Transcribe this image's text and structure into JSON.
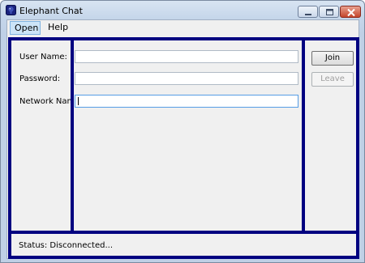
{
  "window": {
    "title": "Elephant Chat"
  },
  "menu": {
    "open_label": "Open",
    "help_label": "Help"
  },
  "form": {
    "username_label": "User Name:",
    "username_value": "",
    "password_label": "Password:",
    "password_value": "",
    "network_label": "Network Name",
    "network_value": ""
  },
  "actions": {
    "join_label": "Join",
    "leave_label": "Leave",
    "leave_enabled": false
  },
  "status": {
    "text": "Status: Disconnected..."
  },
  "icons": {
    "app": "elephant-app-icon",
    "minimize": "minimize-icon",
    "maximize": "maximize-icon",
    "close": "close-icon"
  },
  "colors": {
    "panel_border": "#000080",
    "client_bg": "#f0f0f0",
    "close_button": "#c5452c",
    "menu_highlight": "#cce4f7"
  }
}
